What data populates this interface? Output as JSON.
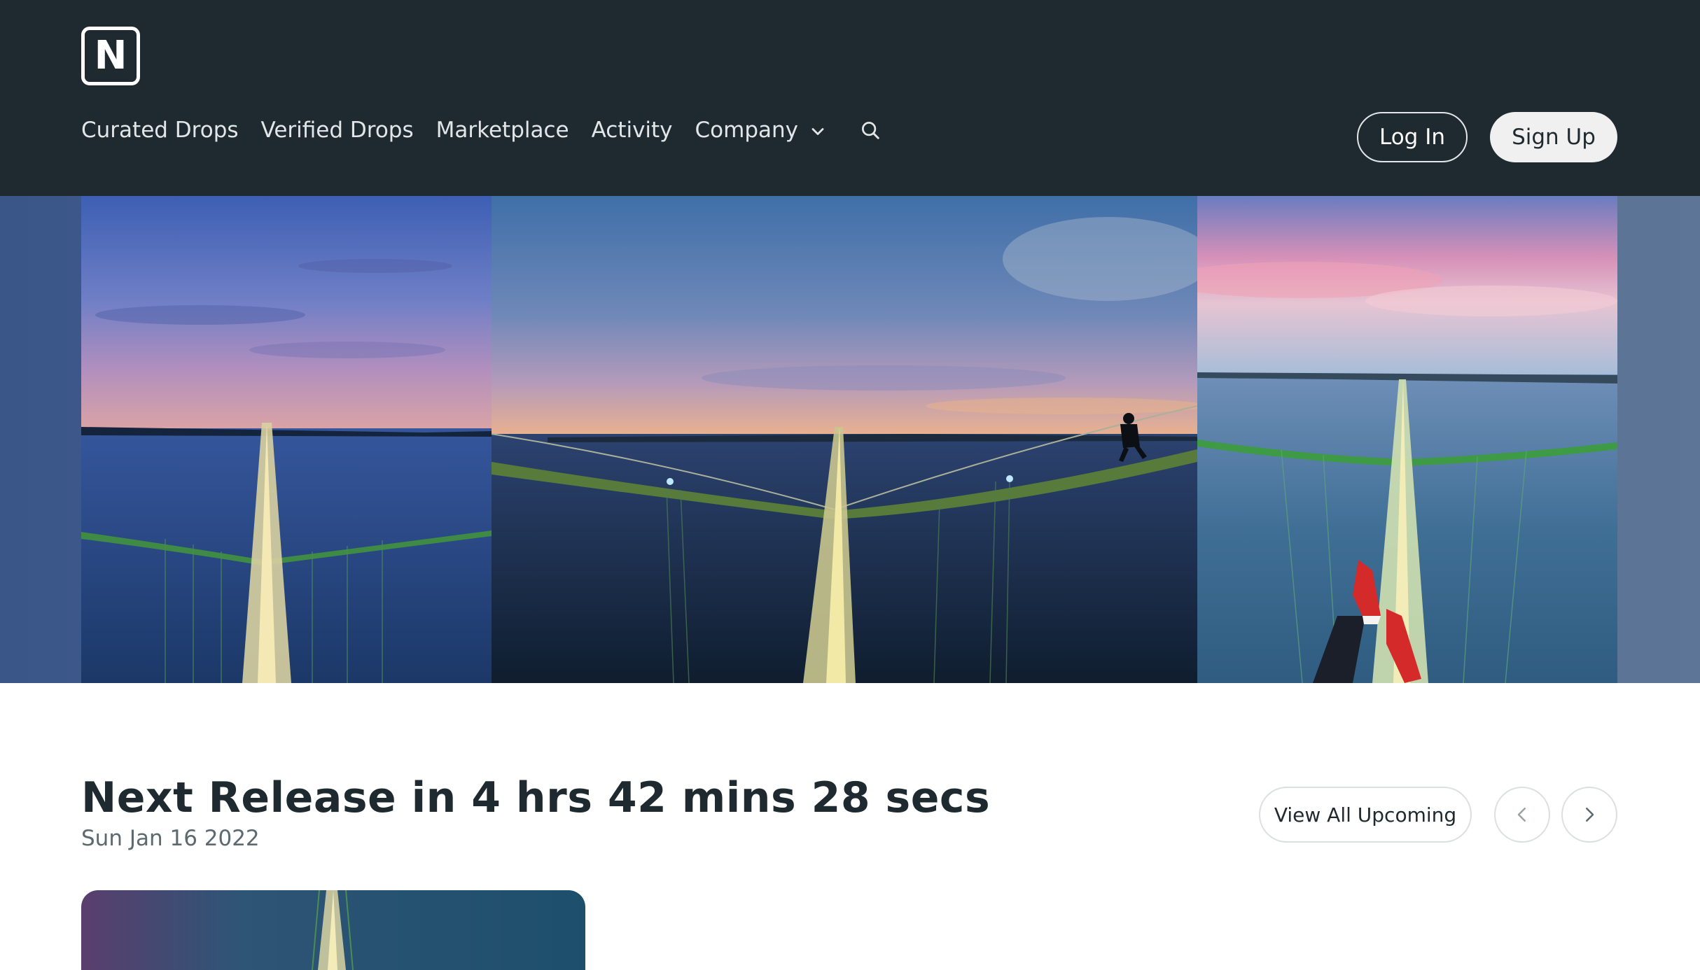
{
  "header": {
    "logo_letter": "N",
    "nav": {
      "curated": "Curated Drops",
      "verified": "Verified Drops",
      "marketplace": "Marketplace",
      "activity": "Activity",
      "company": "Company"
    },
    "login_label": "Log In",
    "signup_label": "Sign Up"
  },
  "hero": {
    "panels": [
      "bridge-dusk-left",
      "bridge-climber-center",
      "bridge-feet-right"
    ]
  },
  "release": {
    "title": "Next Release in 4 hrs 42 mins 28 secs",
    "date": "Sun Jan 16 2022",
    "view_all_label": "View All Upcoming"
  },
  "icons": {
    "search": "search-icon",
    "company_dropdown": "chevron-down-icon",
    "prev": "chevron-left-icon",
    "next": "chevron-right-icon"
  },
  "colors": {
    "header_bg": "#1e2a2f",
    "text_dark": "#1e2a2f",
    "text_muted": "#5c6a70"
  }
}
